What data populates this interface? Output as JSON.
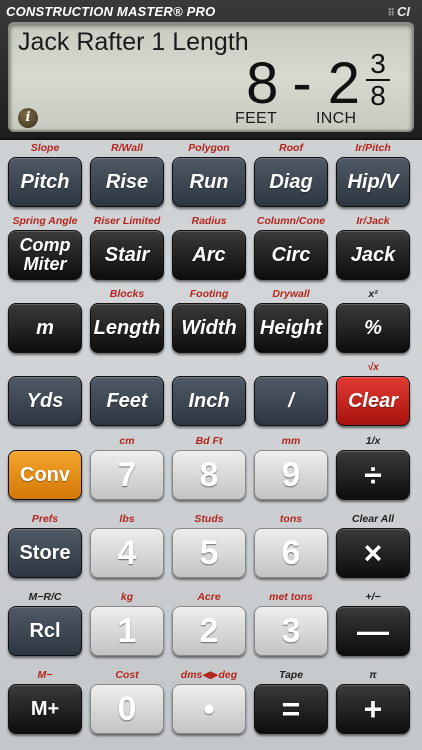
{
  "header": {
    "brand": "CONSTRUCTION MASTER® PRO",
    "logo": "CI"
  },
  "display": {
    "label": "Jack Rafter 1 Length",
    "feet": "8",
    "dash": "-",
    "inch": "2",
    "numerator": "3",
    "denominator": "8",
    "feet_unit": "FEET",
    "inch_unit": "INCH",
    "info_icon": "i"
  },
  "keys": {
    "r1": [
      {
        "label": "Pitch",
        "sec": "Slope"
      },
      {
        "label": "Rise",
        "sec": "R/Wall"
      },
      {
        "label": "Run",
        "sec": "Polygon"
      },
      {
        "label": "Diag",
        "sec": "Roof"
      },
      {
        "label": "Hip/V",
        "sec": "Ir/Pitch"
      }
    ],
    "r2": [
      {
        "label": "Comp Miter",
        "sec": "Spring Angle"
      },
      {
        "label": "Stair",
        "sec": "Riser Limited"
      },
      {
        "label": "Arc",
        "sec": "Radius"
      },
      {
        "label": "Circ",
        "sec": "Column/Cone"
      },
      {
        "label": "Jack",
        "sec": "Ir/Jack"
      }
    ],
    "r3": [
      {
        "label": "m",
        "sec": ""
      },
      {
        "label": "Length",
        "sec": "Blocks"
      },
      {
        "label": "Width",
        "sec": "Footing"
      },
      {
        "label": "Height",
        "sec": "Drywall"
      },
      {
        "label": "%",
        "sec": "x²"
      }
    ],
    "r4": [
      {
        "label": "Yds",
        "sec": ""
      },
      {
        "label": "Feet",
        "sec": ""
      },
      {
        "label": "Inch",
        "sec": ""
      },
      {
        "label": "/",
        "sec": ""
      },
      {
        "label": "Clear",
        "sec": "√x"
      }
    ],
    "r5": [
      {
        "label": "Conv",
        "sec": ""
      },
      {
        "label": "7",
        "sec": "cm"
      },
      {
        "label": "8",
        "sec": "Bd Ft"
      },
      {
        "label": "9",
        "sec": "mm"
      },
      {
        "label": "÷",
        "sec": "1/x"
      }
    ],
    "r6": [
      {
        "label": "Store",
        "sec": "Prefs"
      },
      {
        "label": "4",
        "sec": "lbs"
      },
      {
        "label": "5",
        "sec": "Studs"
      },
      {
        "label": "6",
        "sec": "tons"
      },
      {
        "label": "×",
        "sec": "Clear All"
      }
    ],
    "r7": [
      {
        "label": "Rcl",
        "sec": "M−R/C"
      },
      {
        "label": "1",
        "sec": "kg"
      },
      {
        "label": "2",
        "sec": "Acre"
      },
      {
        "label": "3",
        "sec": "met tons"
      },
      {
        "label": "—",
        "sec": "+/−"
      }
    ],
    "r8": [
      {
        "label": "M+",
        "sec": "M−"
      },
      {
        "label": "0",
        "sec": "Cost"
      },
      {
        "label": "•",
        "sec": "dms◀▶deg"
      },
      {
        "label": "=",
        "sec": "Tape"
      },
      {
        "label": "+",
        "sec": "π"
      }
    ]
  }
}
